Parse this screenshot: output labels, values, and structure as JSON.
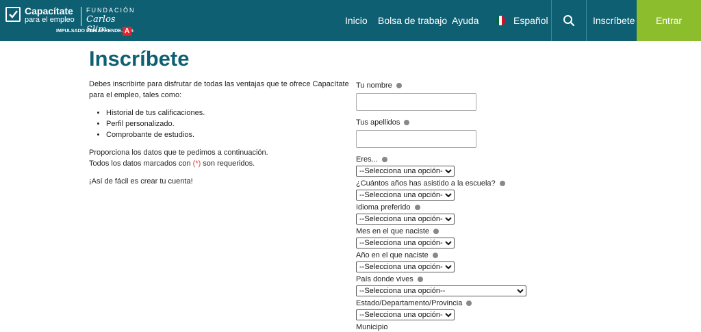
{
  "logo": {
    "brand_line1": "Capacítate",
    "brand_line2": "para el empleo",
    "foundation_line1": "FUNDACIÓN",
    "foundation_line2": "Carlos Slim",
    "powered_by": "IMPULSADO POR APRENDE.ORG",
    "badge": "A"
  },
  "nav": {
    "inicio": "Inicio",
    "bolsa": "Bolsa de trabajo",
    "ayuda": "Ayuda",
    "language": "Español",
    "inscribete": "Inscríbete",
    "entrar": "Entrar"
  },
  "page": {
    "title": "Inscríbete",
    "intro": "Debes inscribirte para disfrutar de todas las ventajas que te ofrece Capacítate para el empleo, tales como:",
    "benefits": [
      "Historial de tus calificaciones.",
      "Perfil personalizado.",
      "Comprobante de estudios."
    ],
    "instructions_line1": "Proporciona los datos que te pedimos a continuación.",
    "instructions_line2_pre": "Todos los datos marcados con ",
    "required_mark": "(*)",
    "instructions_line2_post": " son requeridos.",
    "closing": "¡Así de fácil es crear tu cuenta!"
  },
  "form": {
    "nombre_label": "Tu nombre",
    "apellidos_label": "Tus apellidos",
    "eres_label": "Eres...",
    "anios_escuela_label": "¿Cuántos años has asistido a la escuela?",
    "idioma_label": "Idioma preferido",
    "mes_label": "Mes en el que naciste",
    "anio_label": "Año en el que naciste",
    "pais_label": "País donde vives",
    "estado_label": "Estado/Departamento/Provincia",
    "municipio_label": "Municipio",
    "select_placeholder": "--Selecciona una opción--"
  },
  "colors": {
    "header_bg": "#0f5f73",
    "entrar_bg": "#8cbd2d",
    "title": "#0f5f73",
    "required": "#dd4444"
  }
}
